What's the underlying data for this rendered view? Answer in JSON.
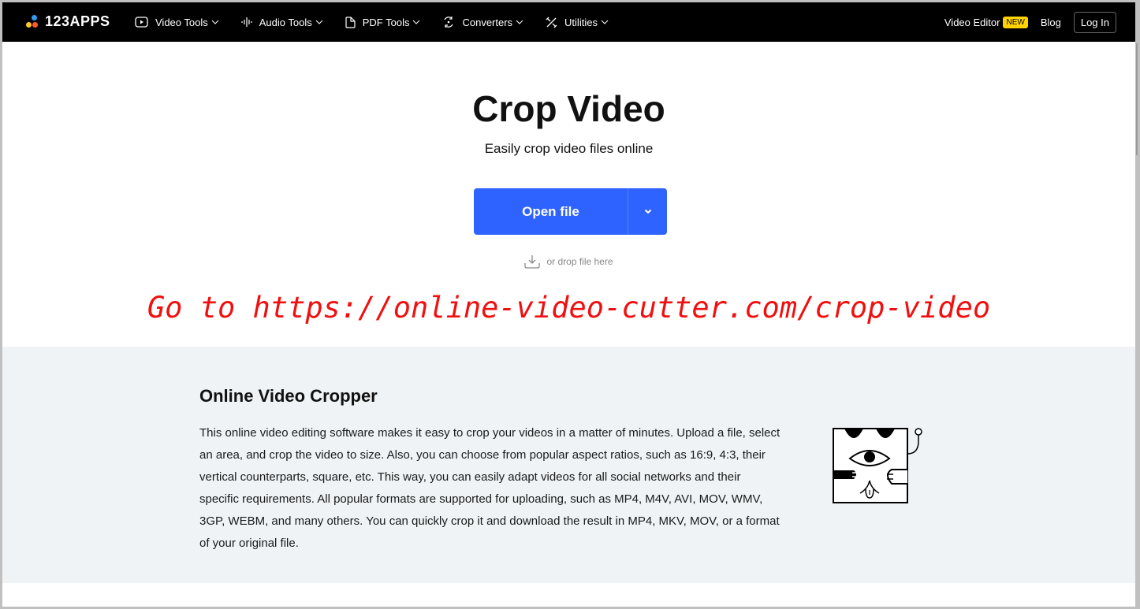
{
  "header": {
    "logo_text": "123APPS",
    "nav": [
      {
        "label": "Video Tools",
        "icon": "play-icon"
      },
      {
        "label": "Audio Tools",
        "icon": "waveform-icon"
      },
      {
        "label": "PDF Tools",
        "icon": "document-icon"
      },
      {
        "label": "Converters",
        "icon": "convert-icon"
      },
      {
        "label": "Utilities",
        "icon": "tools-icon"
      }
    ],
    "video_editor_label": "Video Editor",
    "new_badge": "NEW",
    "blog_label": "Blog",
    "login_label": "Log In"
  },
  "hero": {
    "title": "Crop Video",
    "subtitle": "Easily crop video files online",
    "open_file_label": "Open file",
    "drop_hint": "or drop file here"
  },
  "annotation": {
    "text": "Go to https://online-video-cutter.com/crop-video",
    "color": "#f01010"
  },
  "info": {
    "title": "Online Video Cropper",
    "paragraph": "This online video editing software makes it easy to crop your videos in a matter of minutes. Upload a file, select an area, and crop the video to size. Also, you can choose from popular aspect ratios, such as 16:9, 4:3, their vertical counterparts, square, etc. This way, you can easily adapt videos for all social networks and their specific requirements. All popular formats are supported for uploading, such as MP4, M4V, AVI, MOV, WMV, 3GP, WEBM, and many others. You can quickly crop it and download the result in MP4, MKV, MOV, or a format of your original file."
  },
  "colors": {
    "primary_button": "#2f63ff",
    "header_bg": "#000000",
    "section_bg": "#eff3f6",
    "badge": "#ffd200"
  }
}
